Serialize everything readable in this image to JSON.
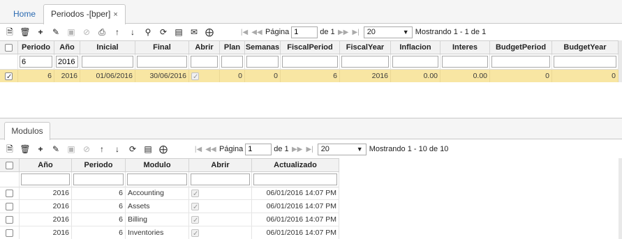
{
  "tabs": [
    {
      "label": "Home"
    },
    {
      "label": "Periodos -[bper]"
    }
  ],
  "close_glyph": "×",
  "top_pager": {
    "page_label": "Página",
    "page_value": "1",
    "of_label": "de 1",
    "page_size": "20",
    "showing": "Mostrando 1 - 1 de 1"
  },
  "top_grid": {
    "columns": [
      "Periodo",
      "Año",
      "Inicial",
      "Final",
      "Abrir",
      "Plan",
      "Semanas",
      "FiscalPeriod",
      "FiscalYear",
      "Inflacion",
      "Interes",
      "BudgetPeriod",
      "BudgetYear"
    ],
    "filters": {
      "periodo": "6",
      "anio": "2016"
    },
    "rows": [
      {
        "periodo": "6",
        "anio": "2016",
        "inicial": "01/06/2016",
        "final": "30/06/2016",
        "abrir": true,
        "plan": "0",
        "semanas": "0",
        "fiscal_period": "6",
        "fiscal_year": "2016",
        "inflacion": "0.00",
        "interes": "0.00",
        "budget_period": "0",
        "budget_year": "0"
      }
    ]
  },
  "sub_tab": {
    "label": "Modulos"
  },
  "bottom_pager": {
    "page_label": "Página",
    "page_value": "1",
    "of_label": "de 1",
    "page_size": "20",
    "showing": "Mostrando 1 - 10 de 10"
  },
  "bottom_grid": {
    "columns": [
      "Año",
      "Periodo",
      "Modulo",
      "Abrir",
      "Actualizado"
    ],
    "rows": [
      {
        "anio": "2016",
        "periodo": "6",
        "modulo": "Accounting",
        "abrir": true,
        "actualizado": "06/01/2016 14:07 PM"
      },
      {
        "anio": "2016",
        "periodo": "6",
        "modulo": "Assets",
        "abrir": true,
        "actualizado": "06/01/2016 14:07 PM"
      },
      {
        "anio": "2016",
        "periodo": "6",
        "modulo": "Billing",
        "abrir": true,
        "actualizado": "06/01/2016 14:07 PM"
      },
      {
        "anio": "2016",
        "periodo": "6",
        "modulo": "Inventories",
        "abrir": true,
        "actualizado": "06/01/2016 14:07 PM"
      }
    ]
  },
  "icons": [
    "new-document-icon",
    "delete-icon",
    "add-icon",
    "edit-icon",
    "save-icon",
    "cancel-icon",
    "print-icon",
    "move-up-icon",
    "move-down-icon",
    "search-icon",
    "refresh-icon",
    "comment-icon",
    "email-icon",
    "more-icon",
    "first-page-icon",
    "prev-page-icon",
    "next-page-icon",
    "last-page-icon",
    "dropdown-arrow-icon"
  ],
  "colors": {
    "selected_row": "#f8e6a3",
    "tab_text": "#2a6ab1"
  }
}
